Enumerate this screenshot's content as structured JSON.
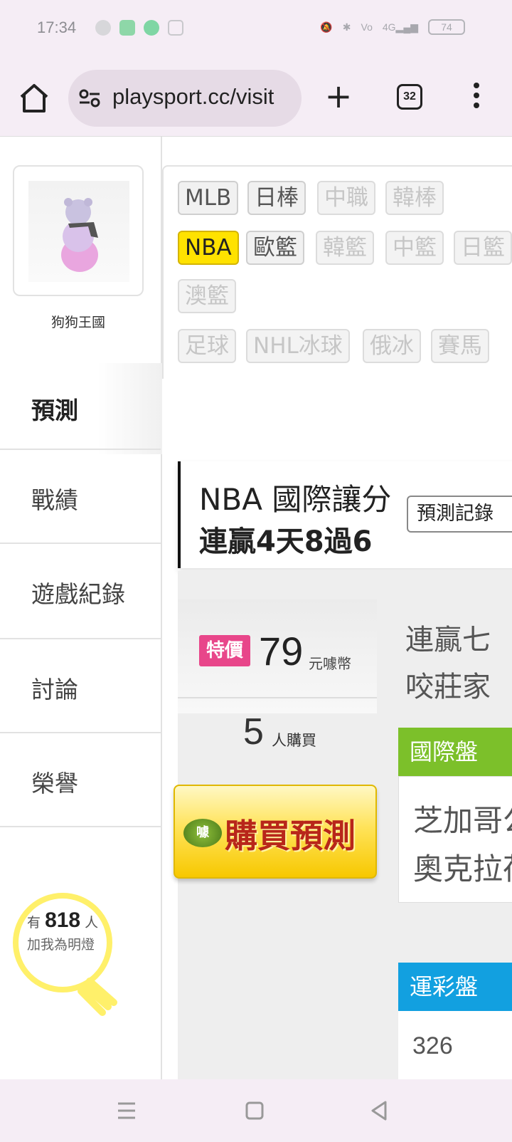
{
  "status_bar": {
    "time": "17:34",
    "battery": "74",
    "network": "4G",
    "icons": [
      "chat-bubble-icon",
      "android-icon",
      "upload-icon",
      "play-icon",
      "mute-icon",
      "bluetooth-icon",
      "volte-icon",
      "signal-icon"
    ]
  },
  "browser": {
    "url": "playsport.cc/visit",
    "tab_count": "32",
    "icons": [
      "home-icon",
      "site-info-icon",
      "plus-icon",
      "tabs-icon",
      "more-menu-icon"
    ]
  },
  "profile": {
    "nickname": "狗狗王國"
  },
  "sidebar": {
    "active": "預測",
    "items": [
      "戰績",
      "遊戲紀錄",
      "討論",
      "榮譽"
    ],
    "fans_prefix": "有",
    "fans_count": "818",
    "fans_suffix": "人",
    "fans_caption": "加我為明燈"
  },
  "leagues": {
    "row1": [
      "MLB",
      "日棒",
      "中職",
      "韓棒"
    ],
    "row2": [
      "NBA",
      "歐籃",
      "韓籃",
      "中籃",
      "日籃"
    ],
    "row3": [
      "澳籃"
    ],
    "row4": [
      "足球",
      "NHL冰球",
      "俄冰",
      "賽馬"
    ],
    "selected": "NBA"
  },
  "prediction": {
    "title": "NBA 國際讓分",
    "subtitle": "連贏4天8過6",
    "record_button": "預測記錄"
  },
  "deal": {
    "sale_badge": "特價",
    "price": "79",
    "price_unit": "元噱幣",
    "buyers": "5",
    "buyers_label": "人購買",
    "buy_button": "購買預測",
    "buy_logo": "噱",
    "desc_line1": "連贏七",
    "desc_line2": "咬莊家",
    "intl_label": "國際盤",
    "team1": "芝加哥公",
    "team2": "奧克拉荷",
    "lottery_label": "運彩盤",
    "lottery_value": "326"
  },
  "colors": {
    "nba_chip": "#ffe200",
    "sale_badge": "#e8468a",
    "intl_bar": "#7cc02a",
    "lottery_bar": "#12a0e0",
    "bulb": "#fff06a"
  }
}
